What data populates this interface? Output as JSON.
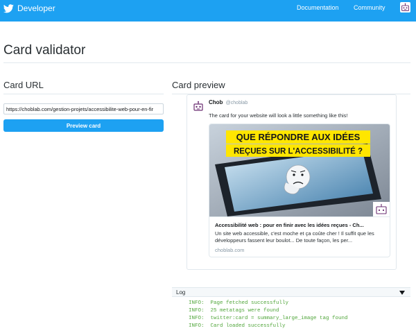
{
  "header": {
    "brand": "Developer",
    "nav": [
      {
        "label": "Documentation"
      },
      {
        "label": "Community"
      }
    ],
    "brand_color": "#1da1f2",
    "icons": [
      "twitter-bird-icon",
      "user-avatar-icon"
    ]
  },
  "page": {
    "title": "Card validator"
  },
  "card_url": {
    "heading": "Card URL",
    "value": "https://choblab.com/gestion-projets/accessibilite-web-pour-en-fir",
    "button_label": "Preview card"
  },
  "card_preview": {
    "heading": "Card preview",
    "tweet": {
      "author_name": "Chob",
      "author_handle": "@choblab",
      "text": "The card for your website will look a little something like this!"
    },
    "card": {
      "image_text_line1": "QUE RÉPONDRE AUX IDÉES",
      "image_text_line2": "REÇUES SUR L'ACCESSIBILITÉ ?",
      "title": "Accessibilité web : pour en finir avec les idées reçues - Ch...",
      "description": "Un site web accessible, c'est moche et ça coûte cher ! Il suffit que les développeurs fassent leur boulot... De toute façon, les per...",
      "domain": "choblab.com"
    }
  },
  "log": {
    "label": "Log",
    "lines": [
      "INFO:  Page fetched successfully",
      "INFO:  25 metatags were found",
      "INFO:  twitter:card = summary_large_image tag found",
      "INFO:  Card loaded successfully"
    ],
    "line_color": "#51a63b"
  }
}
